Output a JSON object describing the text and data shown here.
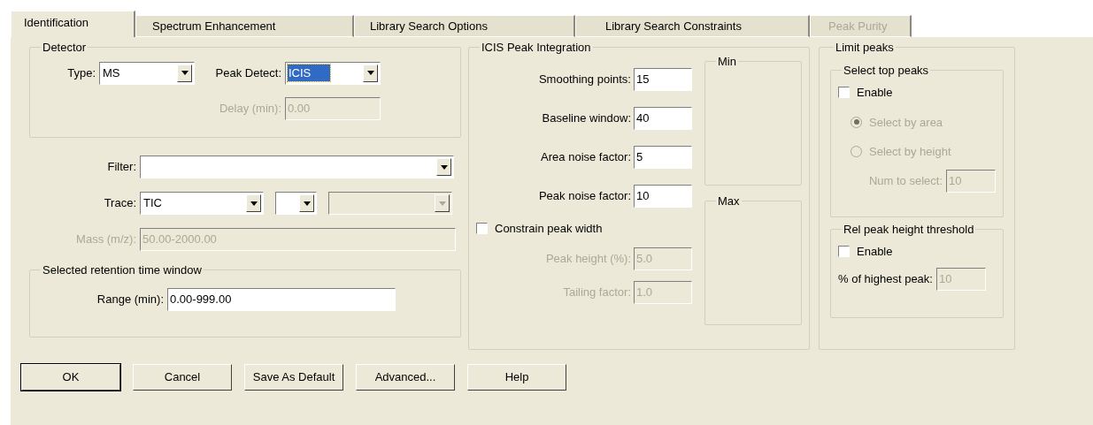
{
  "tabs": [
    {
      "label": "Identification",
      "selected": true,
      "disabled": false
    },
    {
      "label": "Spectrum Enhancement",
      "selected": false,
      "disabled": false
    },
    {
      "label": "Library Search Options",
      "selected": false,
      "disabled": false
    },
    {
      "label": "Library Search Constraints",
      "selected": false,
      "disabled": false
    },
    {
      "label": "Peak Purity",
      "selected": false,
      "disabled": true
    }
  ],
  "detector": {
    "title": "Detector",
    "type": {
      "label": "Type:",
      "value": "MS",
      "focused": false
    },
    "peak_detect": {
      "label": "Peak Detect:",
      "value": "ICIS",
      "focused": true
    },
    "delay": {
      "label": "Delay (min):",
      "value": "0.00",
      "disabled": true
    }
  },
  "filter": {
    "label": "Filter:"
  },
  "trace": {
    "label": "Trace:",
    "combos": [
      {
        "value": "TIC",
        "disabled": false
      },
      {
        "disabled": false
      },
      {
        "disabled": true
      }
    ]
  },
  "mass": {
    "label": "Mass (m/z):",
    "value": "50.00-2000.00",
    "disabled": true
  },
  "retention": {
    "title": "Selected retention time window",
    "range": {
      "label": "Range (min):",
      "value": "0.00-999.00",
      "disabled": false
    }
  },
  "icis": {
    "title": "ICIS Peak Integration",
    "fields": [
      {
        "label": "Smoothing points:",
        "value": "15",
        "disabled": false
      },
      {
        "label": "Baseline window:",
        "value": "40",
        "disabled": false
      },
      {
        "label": "Area noise factor:",
        "value": "5",
        "disabled": false
      },
      {
        "label": "Peak noise factor:",
        "value": "10",
        "disabled": false
      }
    ],
    "constrain": {
      "label": "Constrain peak width",
      "checked": false
    },
    "width_fields": [
      {
        "label": "Peak height (%):",
        "value": "5.0",
        "disabled": true
      },
      {
        "label": "Tailing factor:",
        "value": "1.0",
        "disabled": true
      }
    ],
    "min_title": "Min",
    "max_title": "Max"
  },
  "limit_peaks": {
    "title": "Limit peaks",
    "top": {
      "title": "Select top peaks",
      "enable": {
        "label": "Enable",
        "checked": false
      },
      "radios": [
        {
          "label": "Select by area",
          "selected": true,
          "disabled": true
        },
        {
          "label": "Select by height",
          "selected": false,
          "disabled": true
        }
      ],
      "num": {
        "label": "Num to select:",
        "value": "10",
        "disabled": true
      }
    },
    "rel": {
      "title": "Rel peak height threshold",
      "enable": {
        "label": "Enable",
        "checked": false
      },
      "highest": {
        "label": "% of highest peak:",
        "value": "10",
        "disabled": true
      }
    }
  },
  "buttons": [
    {
      "label": "OK",
      "default": true
    },
    {
      "label": "Cancel",
      "default": false
    },
    {
      "label": "Save As Default",
      "default": false
    },
    {
      "label": "Advanced...",
      "default": false
    },
    {
      "label": "Help",
      "default": false
    }
  ]
}
